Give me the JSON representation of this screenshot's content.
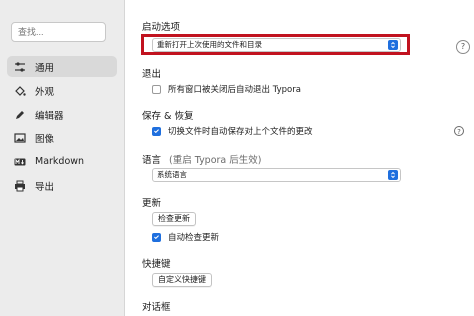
{
  "search": {
    "placeholder": "查找..."
  },
  "sidebar": {
    "items": [
      {
        "label": "通用",
        "icon": "sliders-icon",
        "active": true
      },
      {
        "label": "外观",
        "icon": "paint-bucket-icon"
      },
      {
        "label": "编辑器",
        "icon": "pencil-icon"
      },
      {
        "label": "图像",
        "icon": "image-icon"
      },
      {
        "label": "Markdown",
        "icon": "markdown-icon"
      },
      {
        "label": "导出",
        "icon": "printer-icon"
      }
    ]
  },
  "startup": {
    "title": "启动选项",
    "select_value": "重新打开上次使用的文件和目录"
  },
  "exit": {
    "title": "退出",
    "checkbox_label": "所有窗口被关闭后自动退出 Typora",
    "checked": false
  },
  "save": {
    "title": "保存 & 恢复",
    "checkbox_label": "切换文件时自动保存对上个文件的更改",
    "checked": true,
    "help": "?"
  },
  "language": {
    "title": "语言",
    "note": "(重启 Typora 后生效)",
    "select_value": "系统语言"
  },
  "update": {
    "title": "更新",
    "button": "检查更新",
    "checkbox_label": "自动检查更新",
    "checked": true
  },
  "shortcuts": {
    "title": "快捷键",
    "button": "自定义快捷键"
  },
  "dialog": {
    "title": "对话框"
  },
  "misc": {
    "right_help": "?"
  },
  "colors": {
    "accent": "#1f6fde",
    "highlight": "#c1121f",
    "sidebar_bg": "#ececec"
  }
}
